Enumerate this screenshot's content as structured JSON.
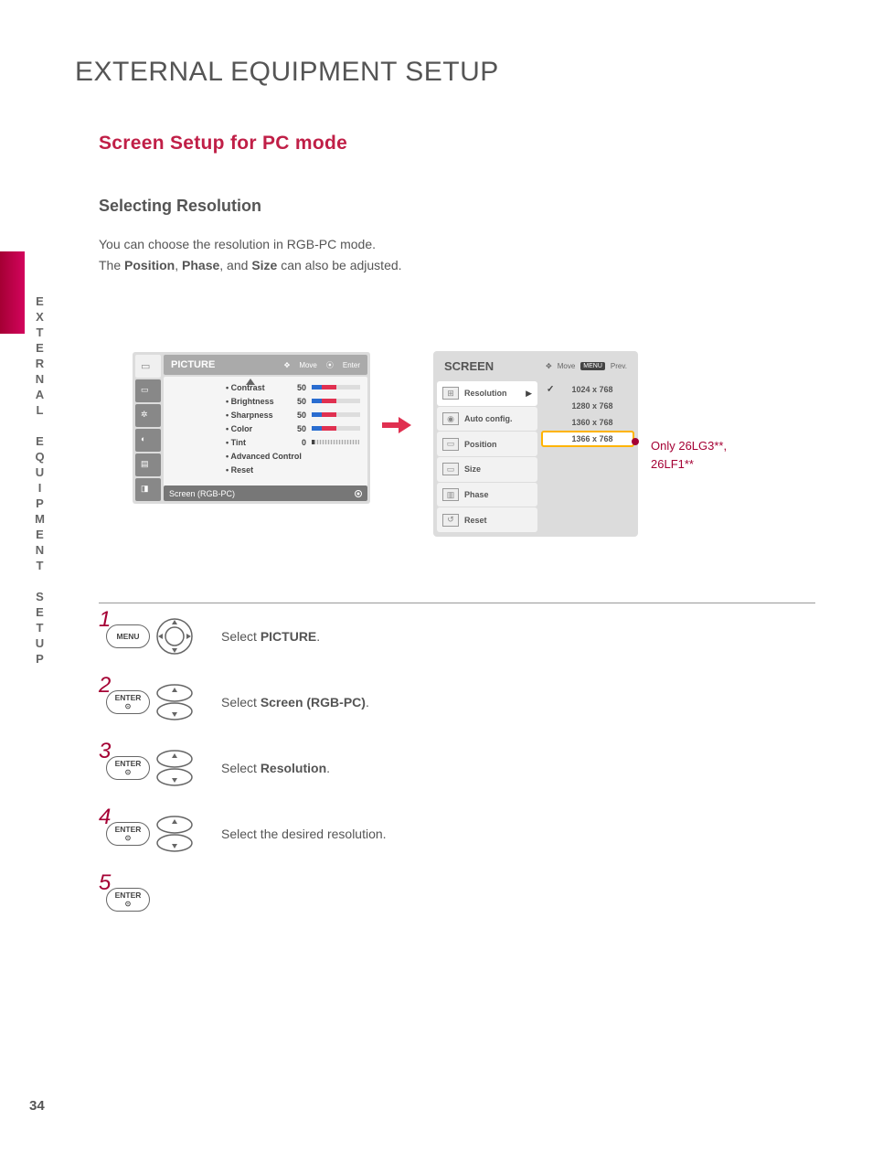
{
  "page": {
    "title": "EXTERNAL EQUIPMENT SETUP",
    "section": "Screen Setup for PC mode",
    "subsection": "Selecting Resolution",
    "body1": "You can choose the resolution in RGB-PC mode.",
    "body2_pre": "The ",
    "body2_b1": "Position",
    "body2_mid1": ", ",
    "body2_b2": "Phase",
    "body2_mid2": ", and ",
    "body2_b3": "Size",
    "body2_post": " can also be adjusted.",
    "side_label": "EXTERNAL EQUIPMENT SETUP",
    "number": "34"
  },
  "osd_picture": {
    "title": "PICTURE",
    "hint_move": "Move",
    "hint_enter": "Enter",
    "rows": [
      {
        "label": "• Contrast",
        "value": "50"
      },
      {
        "label": "• Brightness",
        "value": "50"
      },
      {
        "label": "• Sharpness",
        "value": "50"
      },
      {
        "label": "• Color",
        "value": "50"
      },
      {
        "label": "• Tint",
        "value": "0"
      }
    ],
    "adv": "• Advanced Control",
    "reset": "• Reset",
    "footer": "Screen (RGB-PC)"
  },
  "osd_screen": {
    "title": "SCREEN",
    "hint_move": "Move",
    "hint_prev": "Prev.",
    "menu_tag": "MENU",
    "items": [
      "Resolution",
      "Auto config.",
      "Position",
      "Size",
      "Phase",
      "Reset"
    ],
    "resolutions": [
      "1024 x 768",
      "1280 x 768",
      "1360 x 768",
      "1366 x 768"
    ]
  },
  "annotation": {
    "line1": "Only 26LG3**,",
    "line2": "26LF1**"
  },
  "steps": [
    {
      "num": "1",
      "btn": "MENU",
      "nav": "full",
      "pre": "Select ",
      "bold": "PICTURE",
      "post": "."
    },
    {
      "num": "2",
      "btn": "ENTER",
      "nav": "ud",
      "pre": "Select ",
      "bold": "Screen (RGB-PC)",
      "post": "."
    },
    {
      "num": "3",
      "btn": "ENTER",
      "nav": "ud",
      "pre": "Select ",
      "bold": "Resolution",
      "post": "."
    },
    {
      "num": "4",
      "btn": "ENTER",
      "nav": "ud",
      "pre": "Select the desired resolution.",
      "bold": "",
      "post": ""
    },
    {
      "num": "5",
      "btn": "ENTER",
      "nav": "",
      "pre": "",
      "bold": "",
      "post": ""
    }
  ]
}
